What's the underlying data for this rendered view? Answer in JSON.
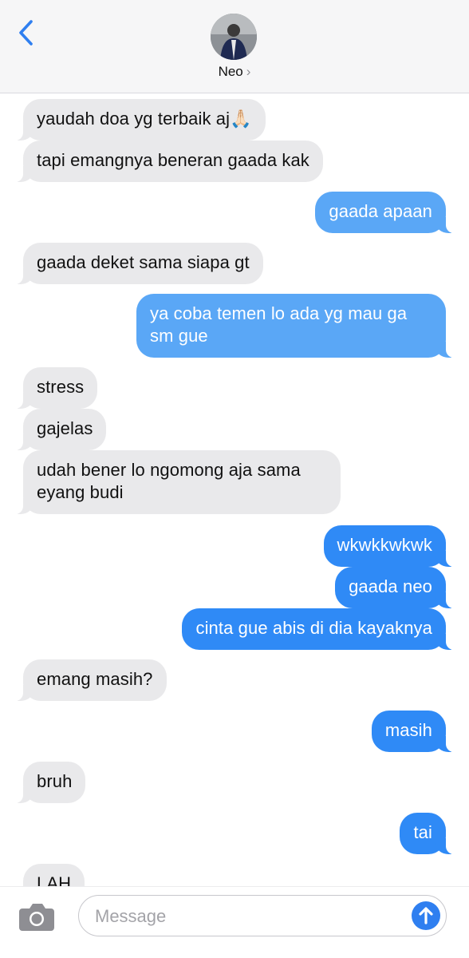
{
  "header": {
    "contact_name": "Neo",
    "chevron": "›"
  },
  "messages": [
    {
      "side": "in",
      "text": "yaudah doa yg terbaik aj🙏🏻"
    },
    {
      "side": "in",
      "text": "tapi emangnya beneran gaada kak"
    },
    {
      "side": "out",
      "text": "gaada apaan"
    },
    {
      "side": "in",
      "text": "gaada deket sama siapa gt"
    },
    {
      "side": "out",
      "text": "ya coba temen lo ada yg mau ga sm gue"
    },
    {
      "side": "in",
      "text": "stress"
    },
    {
      "side": "in",
      "text": "gajelas"
    },
    {
      "side": "in",
      "text": "udah bener lo ngomong aja sama eyang budi"
    },
    {
      "side": "out",
      "text": "wkwkkwkwk"
    },
    {
      "side": "out",
      "text": "gaada neo"
    },
    {
      "side": "out",
      "text": "cinta gue abis di dia kayaknya"
    },
    {
      "side": "in",
      "text": "emang masih?"
    },
    {
      "side": "out",
      "text": "masih"
    },
    {
      "side": "in",
      "text": "bruh"
    },
    {
      "side": "out",
      "text": "tai"
    },
    {
      "side": "in",
      "text": "LAH"
    }
  ],
  "composer": {
    "placeholder": "Message"
  },
  "colors": {
    "outgoing_bubble": "#2f8af6",
    "incoming_bubble": "#e9e9eb",
    "accent": "#2f7ff0"
  },
  "icons": [
    "back-chevron-icon",
    "camera-icon",
    "send-arrow-icon"
  ]
}
